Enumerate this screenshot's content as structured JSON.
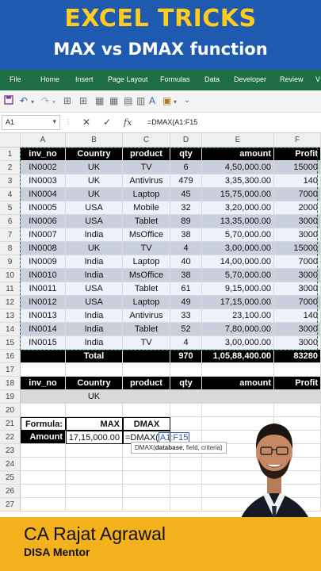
{
  "banner": {
    "title": "EXCEL TRICKS",
    "subtitle": "MAX vs DMAX function"
  },
  "ribbon": {
    "tabs": [
      "File",
      "Home",
      "Insert",
      "Page Layout",
      "Formulas",
      "Data",
      "Developer",
      "Review",
      "V"
    ]
  },
  "formula_bar": {
    "name_box": "A1",
    "cancel": "✕",
    "enter": "✓",
    "fx": "fx",
    "formula": "=DMAX(A1:F15"
  },
  "sheet": {
    "columns": [
      "A",
      "B",
      "C",
      "D",
      "E",
      "F"
    ],
    "rows": [
      "1",
      "2",
      "3",
      "4",
      "5",
      "6",
      "7",
      "8",
      "9",
      "10",
      "11",
      "12",
      "13",
      "14",
      "15",
      "16",
      "17",
      "18",
      "19",
      "20",
      "21",
      "22",
      "23",
      "24",
      "25",
      "26",
      "27"
    ],
    "headers": [
      "inv_no",
      "Country",
      "product",
      "qty",
      "amount",
      "Profit"
    ],
    "records": [
      [
        "IN0002",
        "UK",
        "TV",
        "6",
        "4,50,000.00",
        "15000"
      ],
      [
        "IN0003",
        "UK",
        "Antivirus",
        "479",
        "3,35,300.00",
        "140"
      ],
      [
        "IN0004",
        "UK",
        "Laptop",
        "45",
        "15,75,000.00",
        "7000"
      ],
      [
        "IN0005",
        "USA",
        "Mobile",
        "32",
        "3,20,000.00",
        "2000"
      ],
      [
        "IN0006",
        "USA",
        "Tablet",
        "89",
        "13,35,000.00",
        "3000"
      ],
      [
        "IN0007",
        "India",
        "MsOffice",
        "38",
        "5,70,000.00",
        "3000"
      ],
      [
        "IN0008",
        "UK",
        "TV",
        "4",
        "3,00,000.00",
        "15000"
      ],
      [
        "IN0009",
        "India",
        "Laptop",
        "40",
        "14,00,000.00",
        "7000"
      ],
      [
        "IN0010",
        "India",
        "MsOffice",
        "38",
        "5,70,000.00",
        "3000"
      ],
      [
        "IN0011",
        "USA",
        "Tablet",
        "61",
        "9,15,000.00",
        "3000"
      ],
      [
        "IN0012",
        "USA",
        "Laptop",
        "49",
        "17,15,000.00",
        "7000"
      ],
      [
        "IN0013",
        "India",
        "Antivirus",
        "33",
        "23,100.00",
        "140"
      ],
      [
        "IN0014",
        "India",
        "Tablet",
        "52",
        "7,80,000.00",
        "3000"
      ],
      [
        "IN0015",
        "India",
        "TV",
        "4",
        "3,00,000.00",
        "3000"
      ]
    ],
    "total": {
      "label": "Total",
      "qty": "970",
      "amount": "1,05,88,400.00",
      "profit": "83280"
    },
    "criteria_headers": [
      "inv_no",
      "Country",
      "product",
      "qty",
      "amount",
      "Profit"
    ],
    "criteria_values": [
      "",
      "UK",
      "",
      "",
      "",
      ""
    ],
    "formula_table": {
      "formula_label": "Formula:",
      "max_label": "MAX",
      "dmax_label": "DMAX",
      "amount_label": "Amount",
      "max_value": "17,15,000.00",
      "dmax_prefix": "=DMAX(",
      "dmax_ref": "A1:F15"
    }
  },
  "tooltip": {
    "fn": "DMAX(",
    "arg1": "database",
    "rest": ", field, criteria)"
  },
  "caption": {
    "name": "CA Rajat Agrawal",
    "role": "DISA Mentor"
  },
  "colors": {
    "banner": "#1e5bb0",
    "title": "#ffcc1d",
    "ribbon": "#1f6e43",
    "band": "#c9cfdc",
    "caption": "#f3b21b"
  }
}
